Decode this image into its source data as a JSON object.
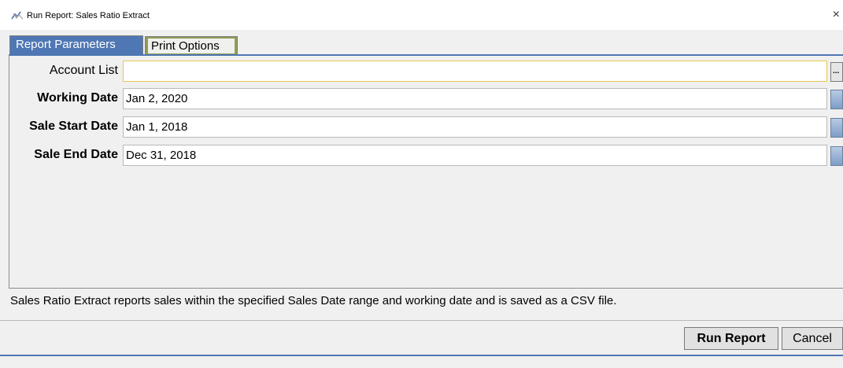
{
  "window": {
    "title": "Run Report: Sales Ratio Extract",
    "close_glyph": "×",
    "icon": "report-app-icon"
  },
  "tabs": [
    {
      "label": "Report Parameters",
      "active": true
    },
    {
      "label": "Print Options",
      "active": false
    }
  ],
  "fields": {
    "account_list": {
      "label": "Account List",
      "value": ""
    },
    "working_date": {
      "label": "Working Date",
      "value": "Jan 2, 2020"
    },
    "sale_start_date": {
      "label": "Sale Start Date",
      "value": "Jan 1, 2018"
    },
    "sale_end_date": {
      "label": "Sale End Date",
      "value": "Dec 31, 2018"
    }
  },
  "ellipsis_glyph": "...",
  "description": "Sales Ratio Extract reports sales within the specified Sales Date range and working date and is saved as a CSV file.",
  "buttons": {
    "run": "Run Report",
    "cancel": "Cancel"
  },
  "colors": {
    "accent": "#4f77b4",
    "inactive_tab": "#8f9e55",
    "focus_border": "#e8c84f"
  }
}
